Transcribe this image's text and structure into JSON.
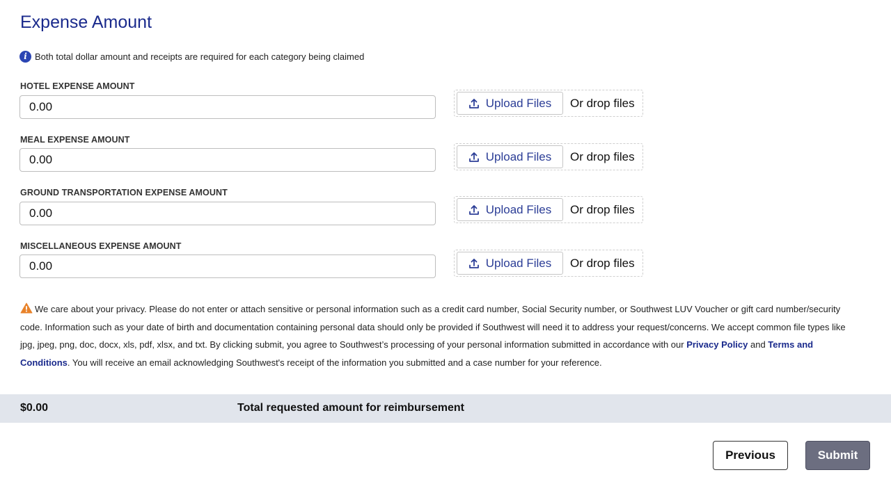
{
  "section": {
    "title": "Expense Amount",
    "info_text": "Both total dollar amount and receipts are required for each category being claimed"
  },
  "fields": [
    {
      "label": "HOTEL EXPENSE AMOUNT",
      "value": "0.00"
    },
    {
      "label": "MEAL EXPENSE AMOUNT",
      "value": "0.00"
    },
    {
      "label": "GROUND TRANSPORTATION EXPENSE AMOUNT",
      "value": "0.00"
    },
    {
      "label": "MISCELLANEOUS EXPENSE AMOUNT",
      "value": "0.00"
    }
  ],
  "upload": {
    "button_label": "Upload Files",
    "drop_text": "Or drop files"
  },
  "privacy": {
    "text_1": "We care about your privacy. Please do not enter or attach sensitive or personal information such as a credit card number, Social Security number, or Southwest LUV Voucher or gift card number/security code. Information such as your date of birth and documentation containing personal data should only be provided if Southwest will need it to address your request/concerns. We accept common file types like jpg, jpeg, png, doc, docx, xls, pdf, xlsx, and txt. By clicking submit, you agree to Southwest’s processing of your personal information submitted in accordance with our ",
    "link_privacy": "Privacy Policy",
    "text_2": " and ",
    "link_terms": "Terms and Conditions",
    "text_3": ". You will receive an email acknowledging Southwest's receipt of the information you submitted and a case number for your reference."
  },
  "total": {
    "amount": "$0.00",
    "label": "Total requested amount for reimbursement"
  },
  "buttons": {
    "previous": "Previous",
    "submit": "Submit"
  },
  "colors": {
    "heading": "#1a2a8c",
    "info_icon": "#2b45b3",
    "warning_icon": "#e8822a",
    "total_bar": "#e1e5ec",
    "submit_button": "#6c6e80"
  }
}
